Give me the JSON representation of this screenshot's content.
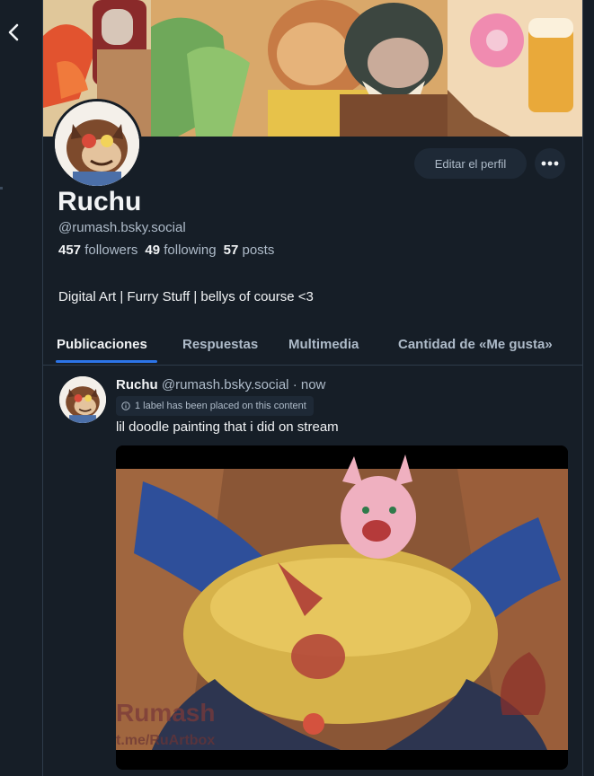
{
  "nav": {
    "back_icon": "chevron-left-icon"
  },
  "profile": {
    "display_name": "Ruchu",
    "handle": "@rumash.bsky.social",
    "followers_count": "457",
    "followers_label": "followers",
    "following_count": "49",
    "following_label": "following",
    "posts_count": "57",
    "posts_label": "posts",
    "bio": "Digital Art | Furry Stuff | bellys of course <3",
    "edit_button": "Editar el perfil",
    "more_icon": "more-horizontal-icon"
  },
  "tabs": [
    {
      "label": "Publicaciones",
      "active": true
    },
    {
      "label": "Respuestas",
      "active": false
    },
    {
      "label": "Multimedia",
      "active": false
    },
    {
      "label": "Cantidad de «Me gusta»",
      "active": false
    }
  ],
  "post": {
    "author_name": "Ruchu",
    "author_handle": "@rumash.bsky.social",
    "separator": "·",
    "time": "now",
    "label_notice": "1 label has been placed on this content",
    "label_icon": "info-icon",
    "text": "lil doodle painting that i did on stream",
    "image_watermark_1": "Rumash",
    "image_watermark_2": "t.me/RuArtbox"
  },
  "colors": {
    "background": "#161e27",
    "accent": "#2c74e8",
    "muted_text": "#aebbc9",
    "button_bg": "#1e2936"
  }
}
